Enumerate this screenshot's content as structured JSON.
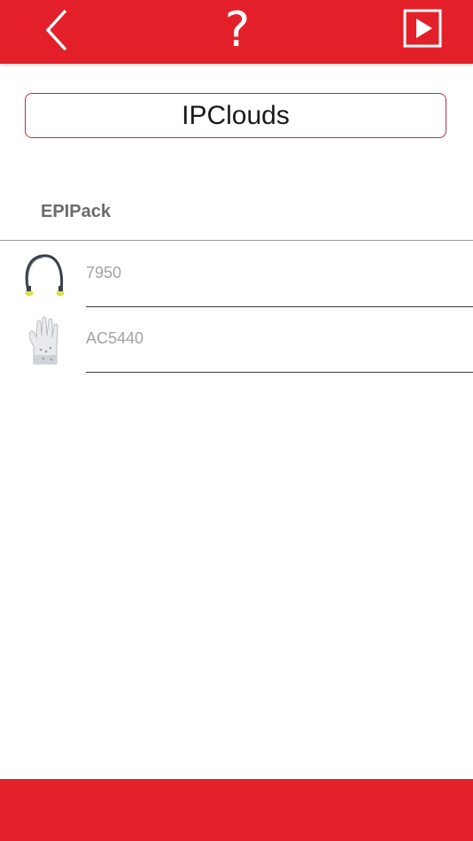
{
  "header": {
    "back_icon": "chevron-left-icon",
    "help_label": "?",
    "play_icon": "play-square-icon",
    "bar_color": "#e3202a"
  },
  "title_box": {
    "text": "IPClouds",
    "border_color": "#b7323a"
  },
  "section": {
    "title": "EPIPack",
    "items": [
      {
        "label": "7950",
        "icon": "ear-protection-headband-icon"
      },
      {
        "label": "AC5440",
        "icon": "protective-glove-icon"
      }
    ]
  },
  "footer": {
    "bar_color": "#e3202a"
  }
}
